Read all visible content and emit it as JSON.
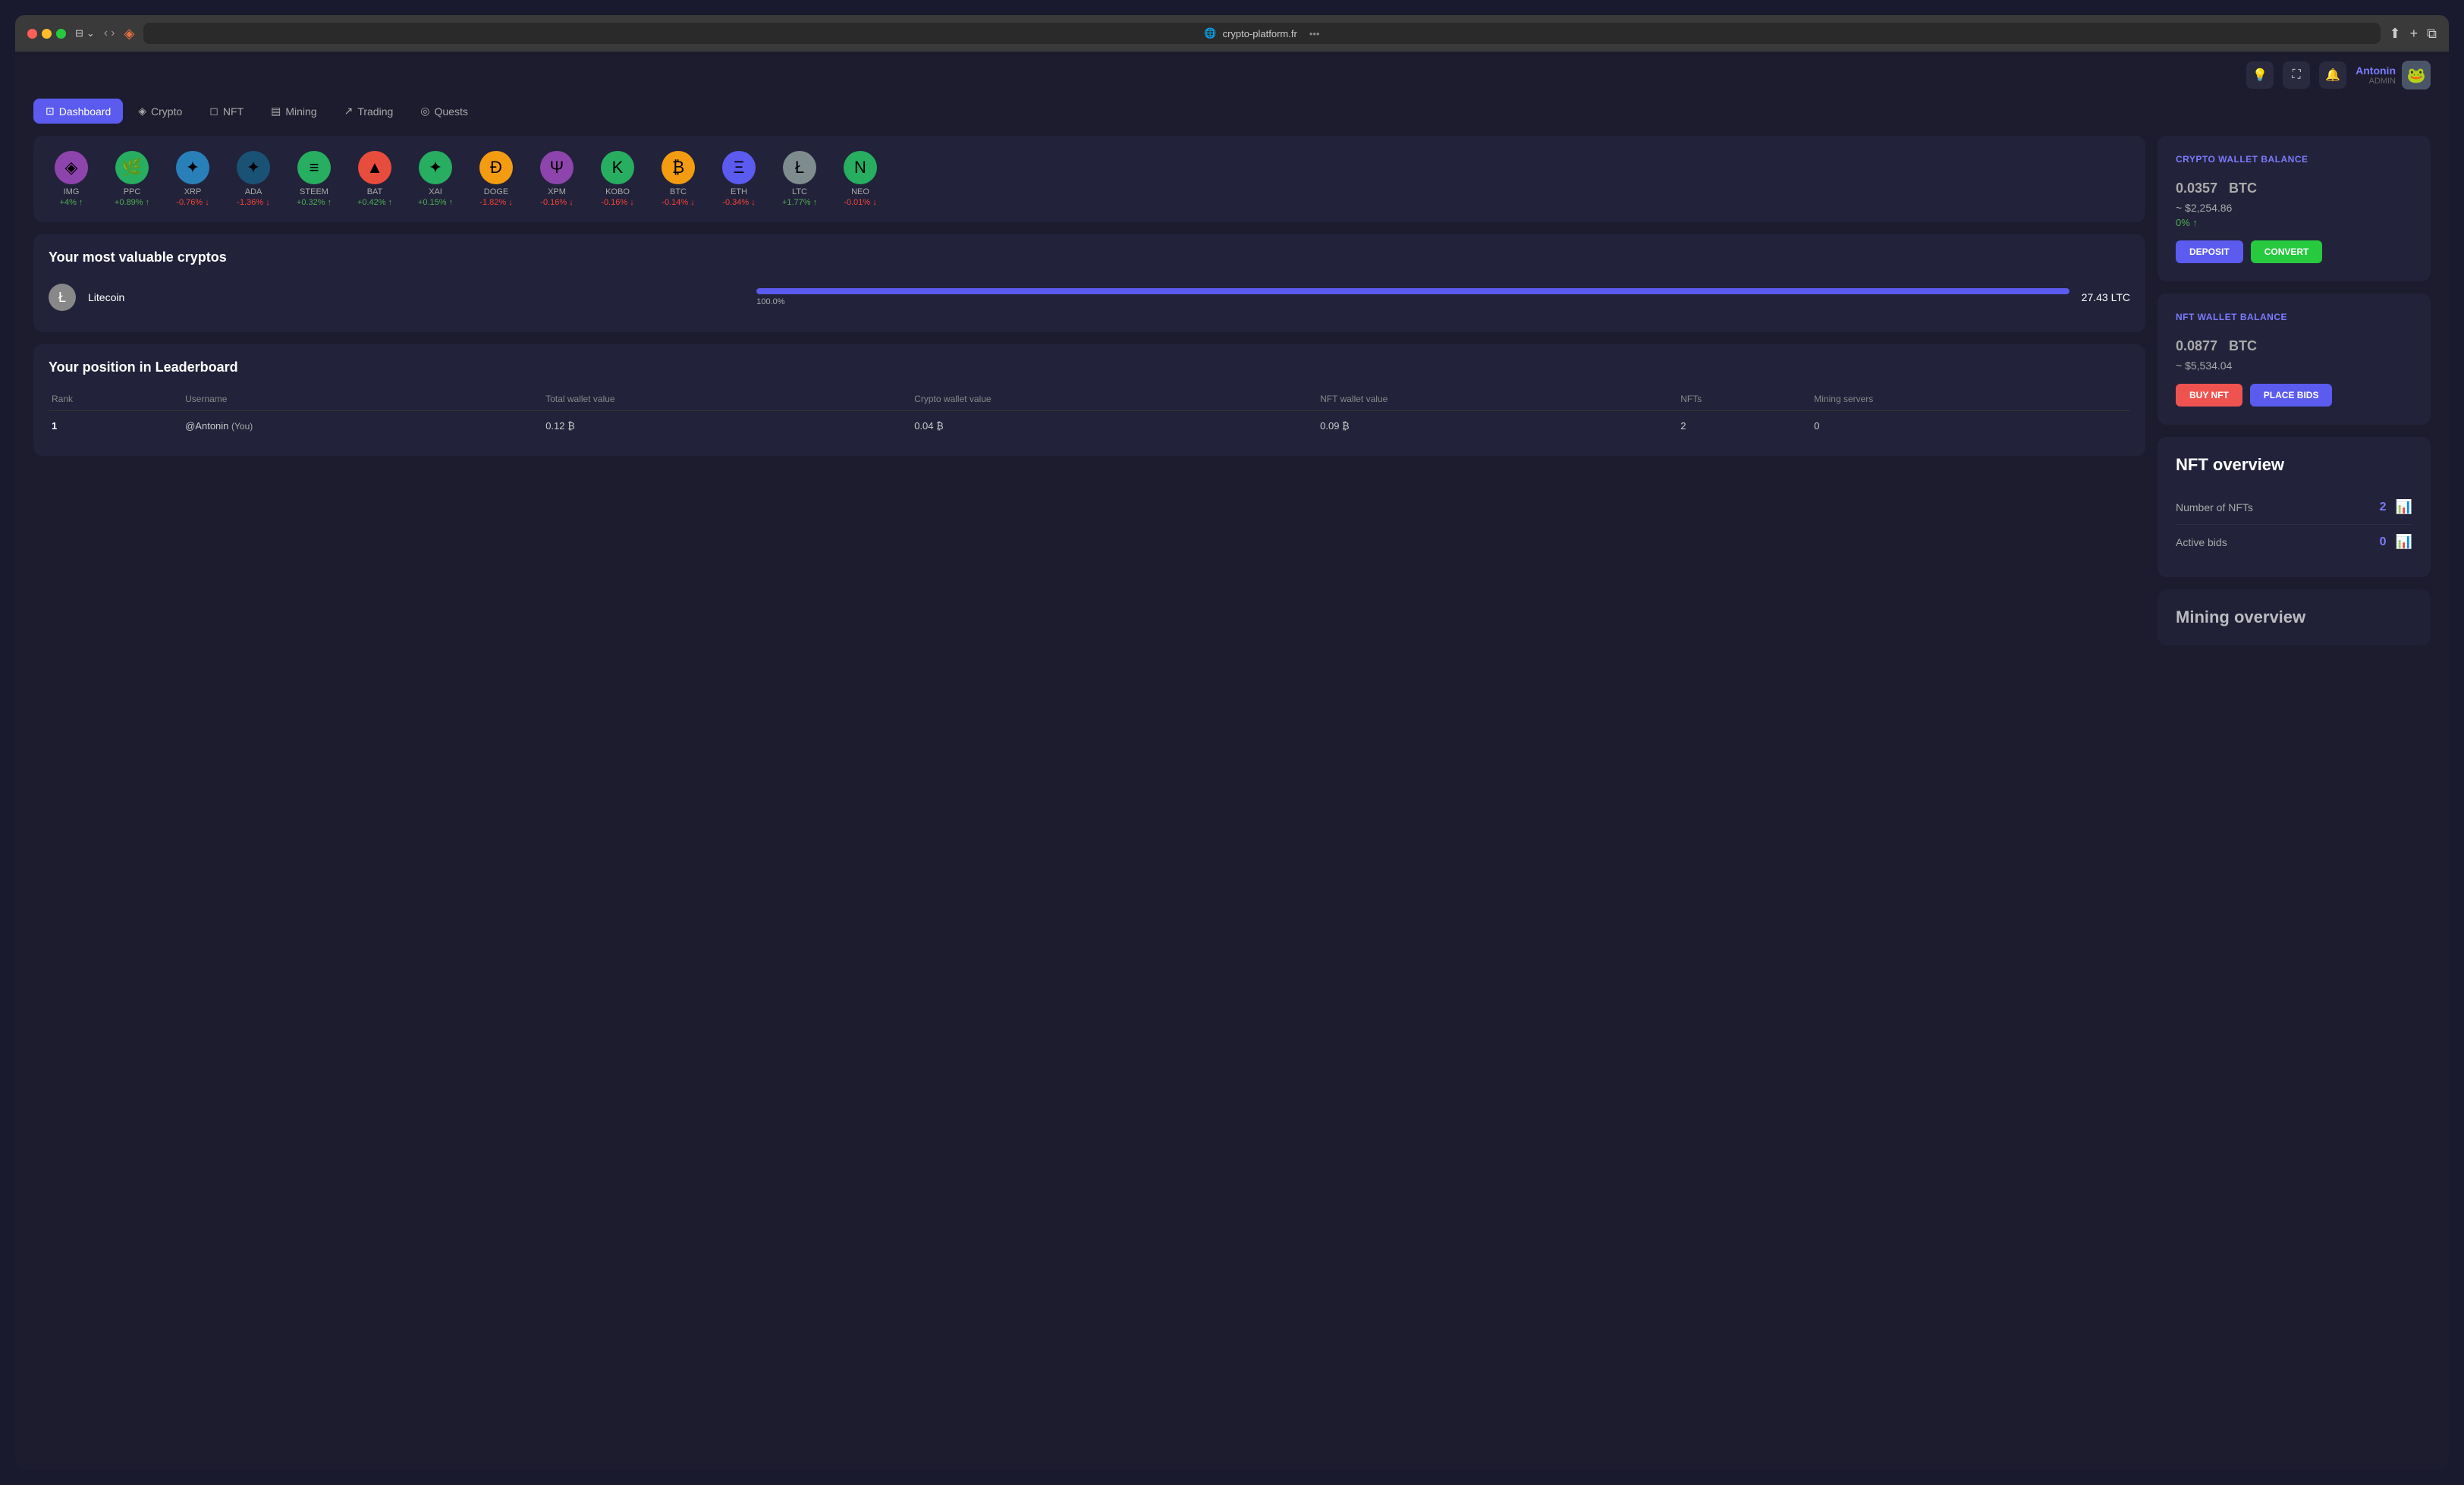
{
  "browser": {
    "url": "crypto-platform.fr",
    "tab_title": "crypto-platform.fr"
  },
  "topbar": {
    "user_name": "Antonin",
    "user_role": "ADMIN",
    "avatar_emoji": "🐸"
  },
  "nav": {
    "items": [
      {
        "id": "dashboard",
        "label": "Dashboard",
        "icon": "⊡",
        "active": true
      },
      {
        "id": "crypto",
        "label": "Crypto",
        "icon": "◈",
        "active": false
      },
      {
        "id": "nft",
        "label": "NFT",
        "icon": "◻",
        "active": false
      },
      {
        "id": "mining",
        "label": "Mining",
        "icon": "▤",
        "active": false
      },
      {
        "id": "trading",
        "label": "Trading",
        "icon": "↗",
        "active": false
      },
      {
        "id": "quests",
        "label": "Quests",
        "icon": "◎",
        "active": false
      }
    ]
  },
  "ticker": {
    "coins": [
      {
        "symbol": "IMG",
        "change": "+4%",
        "up": true,
        "color": "#e74c3c",
        "emoji": "🔴"
      },
      {
        "symbol": "PPC",
        "change": "+0.89%",
        "up": true,
        "color": "#27ae60",
        "emoji": "🟢"
      },
      {
        "symbol": "XRP",
        "change": "-0.76%",
        "up": false,
        "color": "#3498db",
        "emoji": "🔵"
      },
      {
        "symbol": "ADA",
        "change": "-1.36%",
        "up": false,
        "color": "#2980b9",
        "emoji": "🔵"
      },
      {
        "symbol": "STEEM",
        "change": "+0.32%",
        "up": true,
        "color": "#27ae60",
        "emoji": "🟢"
      },
      {
        "symbol": "BAT",
        "change": "+0.42%",
        "up": true,
        "color": "#e74c3c",
        "emoji": "🔴"
      },
      {
        "symbol": "XAI",
        "change": "+0.15%",
        "up": true,
        "color": "#27ae60",
        "emoji": "🟢"
      },
      {
        "symbol": "DOGE",
        "change": "-1.82%",
        "up": false,
        "color": "#f39c12",
        "emoji": "🟡"
      },
      {
        "symbol": "XPM",
        "change": "-0.16%",
        "up": false,
        "color": "#8e44ad",
        "emoji": "🟣"
      },
      {
        "symbol": "KOBO",
        "change": "-0.16%",
        "up": false,
        "color": "#27ae60",
        "emoji": "🟢"
      },
      {
        "symbol": "BTC",
        "change": "-0.14%",
        "up": false,
        "color": "#f39c12",
        "emoji": "🟡"
      },
      {
        "symbol": "ETH",
        "change": "-0.34%",
        "up": false,
        "color": "#5b5bef",
        "emoji": "🔵"
      },
      {
        "symbol": "LTC",
        "change": "+1.77%",
        "up": true,
        "color": "#7f8c8d",
        "emoji": "⚫"
      },
      {
        "symbol": "NEO",
        "change": "-0.01%",
        "up": false,
        "color": "#27ae60",
        "emoji": "🟢"
      }
    ]
  },
  "valuable_cryptos": {
    "title": "Your most valuable cryptos",
    "items": [
      {
        "name": "Litecoin",
        "symbol": "LTC",
        "progress": 100,
        "progress_label": "100.0%",
        "value": "27.43 LTC",
        "color": "#7f8c8d",
        "emoji": "Ł"
      }
    ]
  },
  "leaderboard": {
    "title": "Your position in Leaderboard",
    "columns": [
      "Rank",
      "Username",
      "Total wallet value",
      "Crypto wallet value",
      "NFT wallet value",
      "NFTs",
      "Mining servers"
    ],
    "rows": [
      {
        "rank": "1",
        "username": "@Antonin",
        "you_tag": "(You)",
        "total_wallet": "0.12 ₿",
        "crypto_wallet": "0.04 ₿",
        "nft_wallet": "0.09 ₿",
        "nfts": "2",
        "mining_servers": "0"
      }
    ]
  },
  "crypto_wallet": {
    "label": "CRYPTO WALLET BALANCE",
    "balance": "0.0357",
    "currency": "BTC",
    "usd_value": "~ $2,254.86",
    "change": "0%",
    "change_up": true,
    "deposit_label": "DEPOSIT",
    "convert_label": "CONVERT"
  },
  "nft_wallet": {
    "label": "NFT WALLET BALANCE",
    "balance": "0.0877",
    "currency": "BTC",
    "usd_value": "~ $5,534.04",
    "buy_nft_label": "BUY NFT",
    "place_bids_label": "PLACE BIDS"
  },
  "nft_overview": {
    "title": "NFT overview",
    "items": [
      {
        "label": "Number of NFTs",
        "value": "2"
      },
      {
        "label": "Active bids",
        "value": "0"
      }
    ]
  },
  "mining_overview": {
    "title": "Mining overview"
  }
}
